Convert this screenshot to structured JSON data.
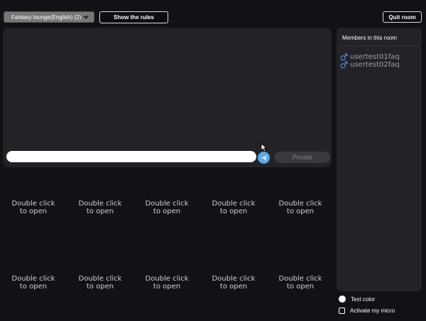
{
  "header": {
    "room_select_value": "Fantasy lounge(English) (2)",
    "rules_button": "Show the rules",
    "quit_button": "Quit room"
  },
  "chat": {
    "input_value": "",
    "private_button": "Private"
  },
  "video_tiles": {
    "line1": "Double click",
    "line2": "to open"
  },
  "members": {
    "title": "Members in this room",
    "list": [
      {
        "name": "usertest01faq",
        "icon": "male-icon"
      },
      {
        "name": "usertest02faq",
        "icon": "male-icon"
      }
    ]
  },
  "options": {
    "text_color_label": "Text color",
    "activate_micro_label": "Activate my micro"
  },
  "colors": {
    "background": "#121115",
    "panel": "#232226",
    "send_button": "#5aaae8",
    "male_icon": "#4f7fc8"
  }
}
